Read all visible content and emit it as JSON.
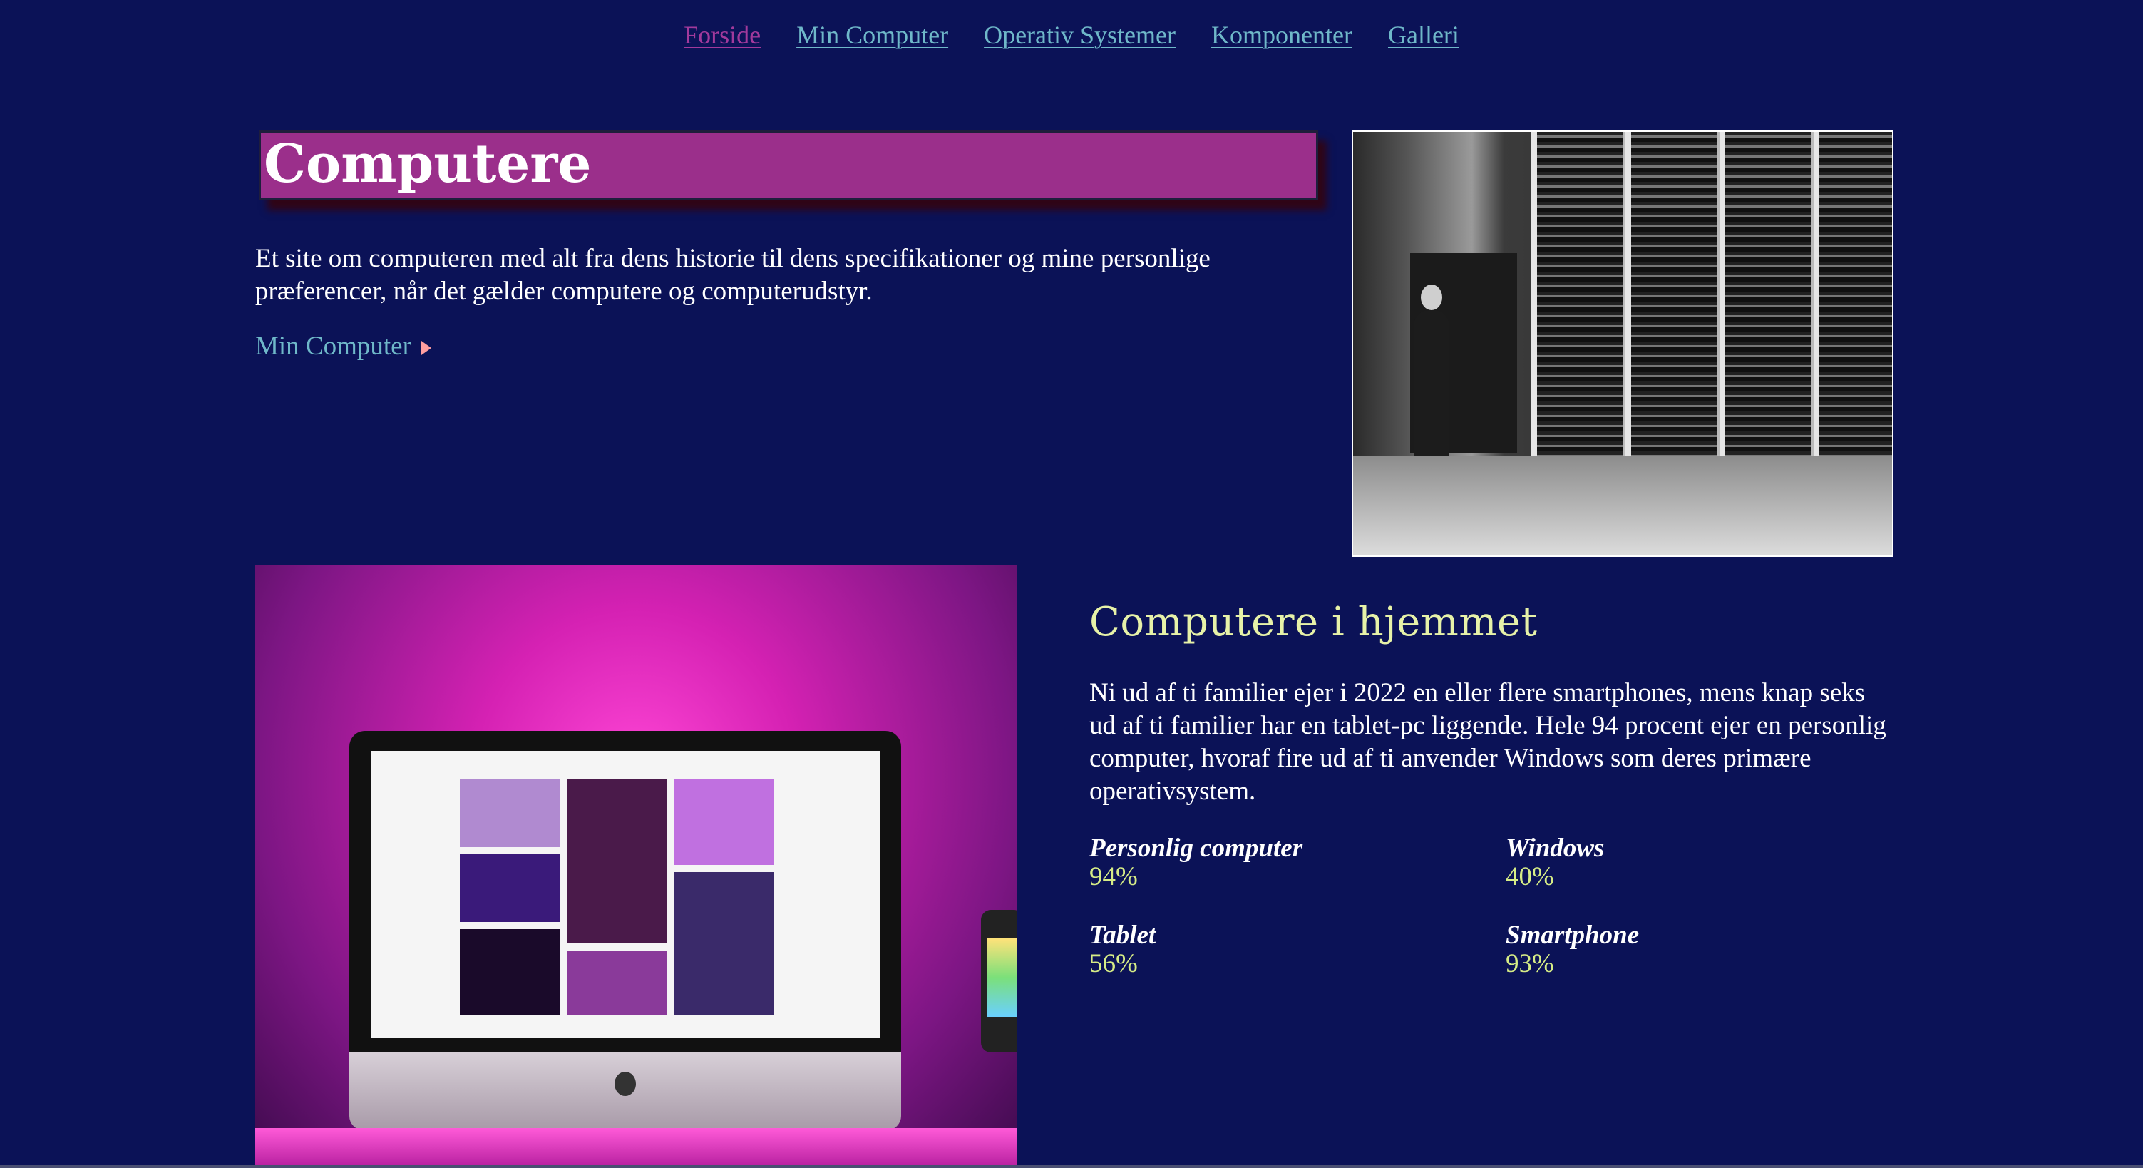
{
  "nav": {
    "items": [
      {
        "label": "Forside",
        "active": true
      },
      {
        "label": "Min Computer",
        "active": false
      },
      {
        "label": "Operativ Systemer",
        "active": false
      },
      {
        "label": "Komponenter",
        "active": false
      },
      {
        "label": "Galleri",
        "active": false
      }
    ]
  },
  "hero": {
    "title": "Computere",
    "intro": "Et site om computeren med alt fra dens historie til dens specifikationer og mine personlige præferencer, når det gælder computere og computerudstyr.",
    "cta_label": "Min Computer"
  },
  "section": {
    "heading": "Computere i hjemmet",
    "body": "Ni ud af ti familier ejer i 2022 en eller flere smartphones, mens knap seks ud af ti familier har en tablet-pc liggende. Hele 94 procent ejer en personlig computer, hvoraf fire ud af ti anvender Windows som deres primære operativsystem."
  },
  "stats": [
    {
      "label": "Personlig computer",
      "value": "94%"
    },
    {
      "label": "Windows",
      "value": "40%"
    },
    {
      "label": "Tablet",
      "value": "56%"
    },
    {
      "label": "Smartphone",
      "value": "93%"
    }
  ],
  "colors": {
    "background": "#0b1257",
    "nav_link": "#6fb8c9",
    "nav_active": "#a23a9c",
    "title_box": "#9b2f8b",
    "heading": "#e7f2a8",
    "stat_value": "#d6ec86",
    "cta_arrow": "#ff9ea0"
  }
}
